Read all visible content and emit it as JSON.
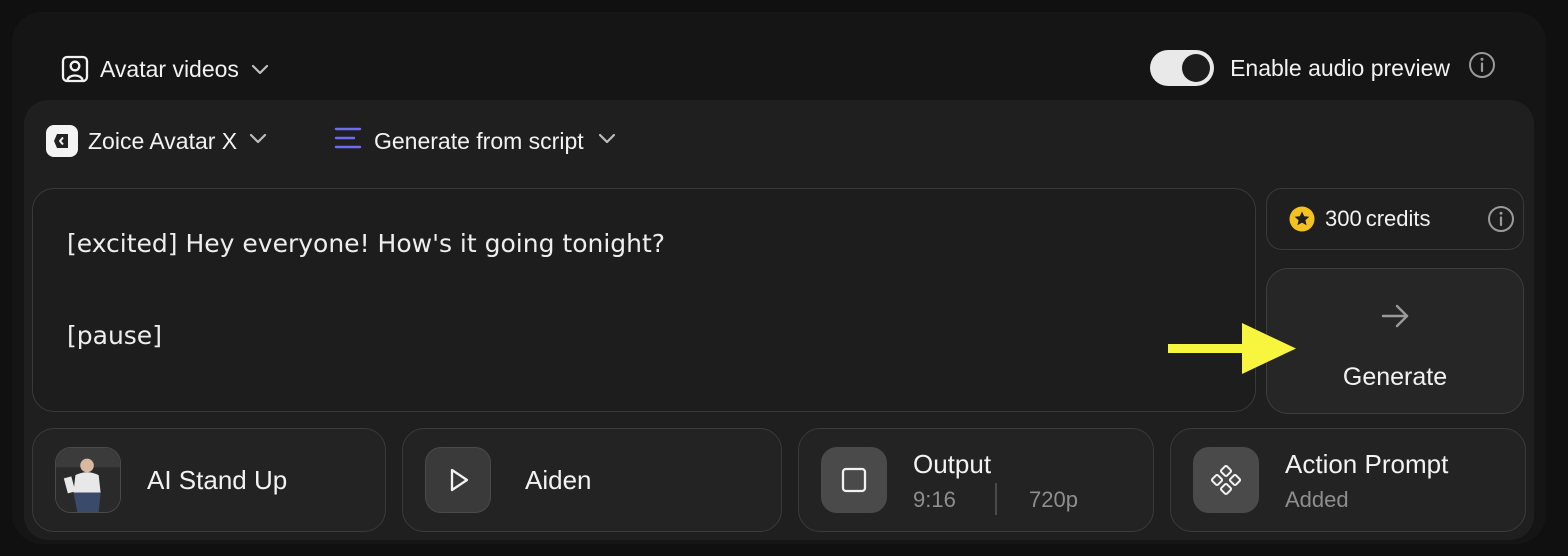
{
  "header": {
    "mode_label": "Avatar videos",
    "mode_icon": "avatar-portrait-icon",
    "audio_preview_label": "Enable audio preview",
    "audio_preview_enabled": true
  },
  "toolbar": {
    "model_label": "Zoice Avatar X",
    "source_label": "Generate from script",
    "source_icon": "lines-icon"
  },
  "script": {
    "lines": [
      "[excited] Hey everyone! How's it going tonight?",
      "[pause]"
    ]
  },
  "credits": {
    "amount": "300",
    "unit": "credits",
    "icon": "star-coin-icon"
  },
  "generate": {
    "label": "Generate"
  },
  "cards": {
    "avatar": {
      "title": "AI Stand Up"
    },
    "voice": {
      "title": "Aiden",
      "icon": "play-icon"
    },
    "output": {
      "title": "Output",
      "aspect": "9:16",
      "resolution": "720p",
      "icon": "square-icon"
    },
    "action": {
      "title": "Action Prompt",
      "status": "Added",
      "icon": "diamond-dots-icon"
    }
  },
  "colors": {
    "accent_annotation": "#f8f53f",
    "credit_coin": "#f4c21f",
    "source_icon": "#6e6cf0"
  }
}
